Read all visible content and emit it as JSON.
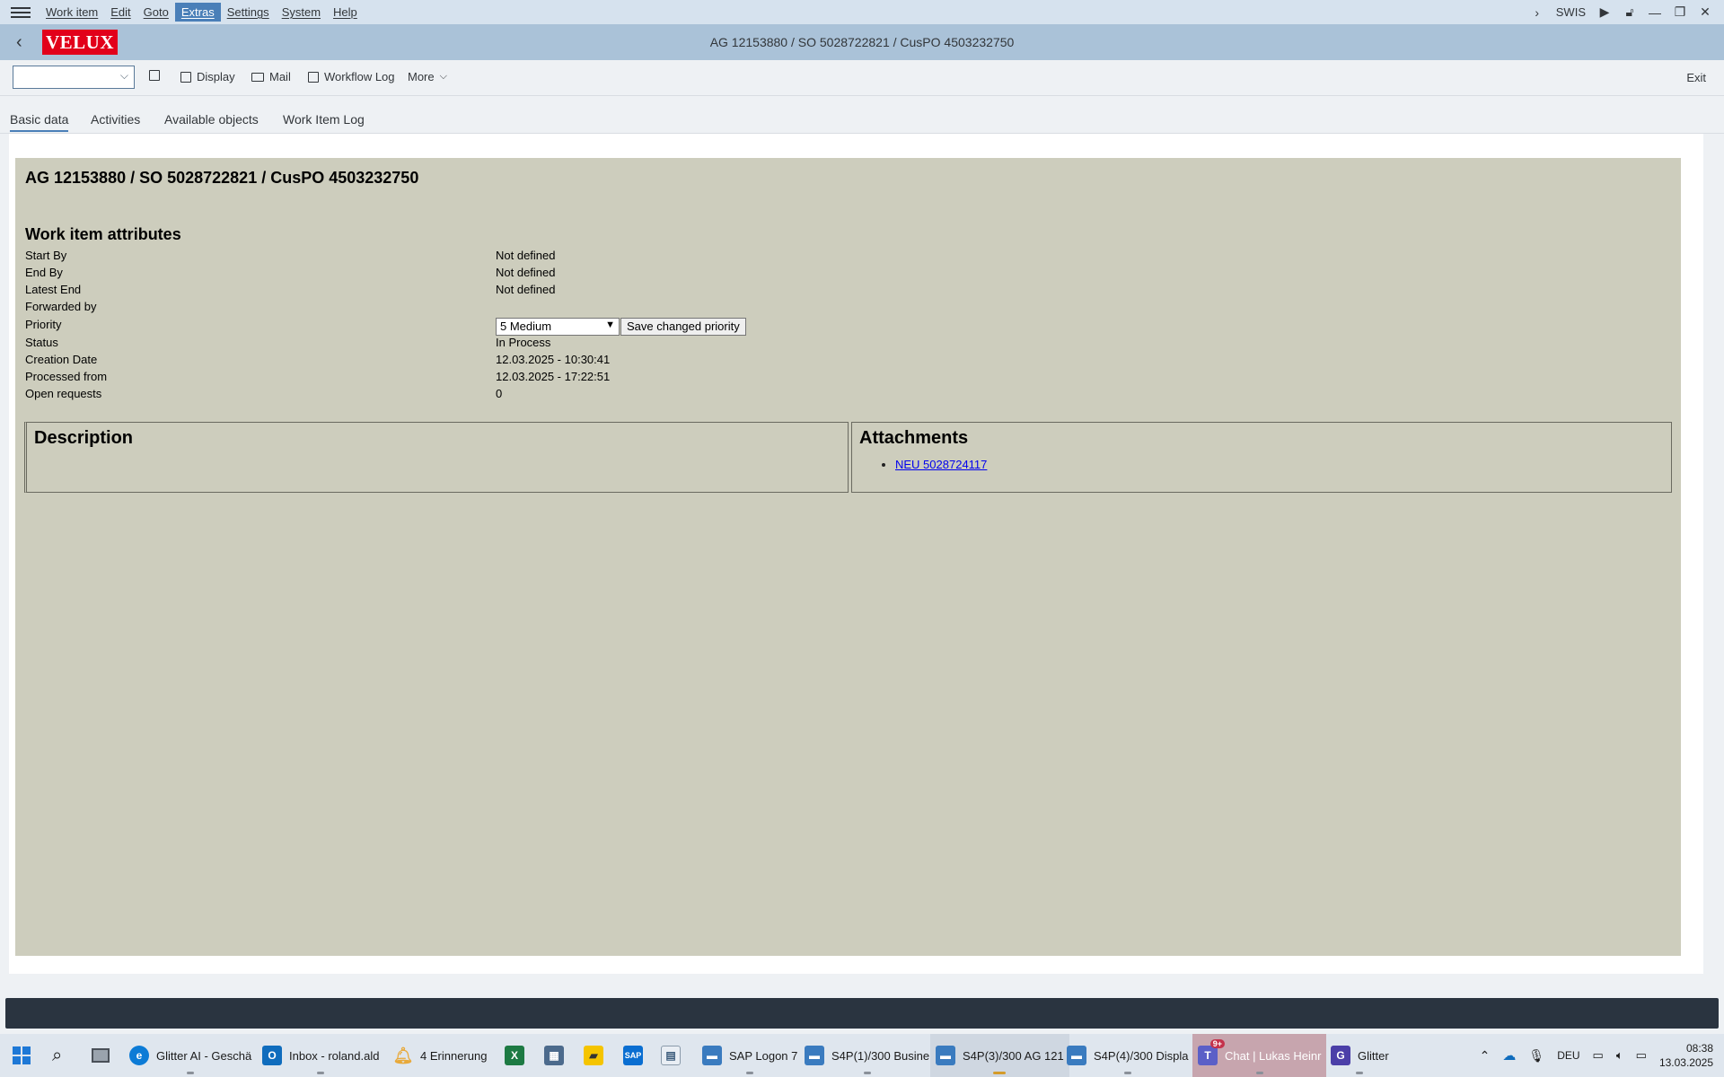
{
  "menubar": {
    "items": [
      "Work item",
      "Edit",
      "Goto",
      "Extras",
      "Settings",
      "System",
      "Help"
    ],
    "active": "Extras",
    "system_id": "SWIS"
  },
  "titlebar": {
    "logo": "VELUX",
    "title": "AG 12153880 / SO 5028722821 / CusPO 4503232750"
  },
  "toolbar": {
    "command_value": "",
    "display": "Display",
    "mail": "Mail",
    "workflow_log": "Workflow Log",
    "more": "More",
    "exit": "Exit"
  },
  "tabs": [
    "Basic data",
    "Activities",
    "Available objects",
    "Work Item Log"
  ],
  "selected_tab": "Basic data",
  "content": {
    "heading": "AG 12153880 / SO 5028722821 / CusPO 4503232750",
    "attributes_heading": "Work item attributes",
    "attributes": [
      {
        "label": "Start By",
        "value": "Not defined"
      },
      {
        "label": "End By",
        "value": "Not defined"
      },
      {
        "label": "Latest End",
        "value": "Not defined"
      },
      {
        "label": "Forwarded by",
        "value": ""
      },
      {
        "label": "Priority",
        "value": "5 Medium"
      },
      {
        "label": "Status",
        "value": "In Process"
      },
      {
        "label": "Creation Date",
        "value": "12.03.2025 - 10:30:41"
      },
      {
        "label": "Processed from",
        "value": "12.03.2025 - 17:22:51"
      },
      {
        "label": "Open requests",
        "value": "0"
      }
    ],
    "save_priority_button": "Save changed priority",
    "description_heading": "Description",
    "attachments_heading": "Attachments",
    "attachments": [
      "NEU 5028724117"
    ]
  },
  "taskbar": {
    "apps": [
      {
        "label": "Glitter AI - Geschä",
        "color": "#0c7bd6"
      },
      {
        "label": "Inbox - roland.ald",
        "color": "#0f6cbd"
      },
      {
        "label": "4 Erinnerung",
        "color": "#e8a93a"
      },
      {
        "label": "SAP Logon 7",
        "color": "#3a7bbf"
      },
      {
        "label": "S4P(1)/300 Busine",
        "color": "#3a7bbf"
      },
      {
        "label": "S4P(3)/300 AG 121",
        "color": "#3a7bbf"
      },
      {
        "label": "S4P(4)/300 Displa",
        "color": "#3a7bbf"
      },
      {
        "label": "Chat | Lukas Heinr",
        "color": "#5b5fc7"
      },
      {
        "label": "Glitter",
        "color": "#4b3fa8"
      }
    ],
    "teams_badge": "9+",
    "language": "DEU",
    "time": "08:38",
    "date": "13.03.2025"
  }
}
